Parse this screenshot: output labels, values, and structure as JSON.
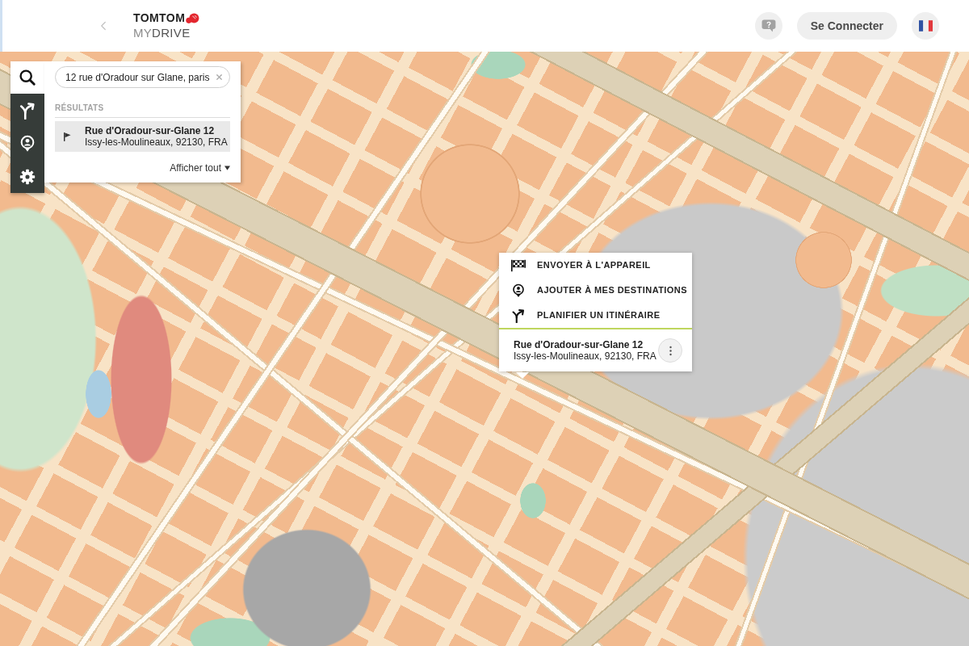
{
  "header": {
    "logo": {
      "brand": "TOMTOM",
      "product_light": "MY",
      "product_dark": "DRIVE"
    },
    "login_button": "Se Connecter"
  },
  "sidebar": {
    "items": [
      {
        "selected": true
      },
      {
        "selected": false
      },
      {
        "selected": false
      },
      {
        "selected": false
      }
    ]
  },
  "search": {
    "value": "12 rue d'Oradour sur Glane, paris",
    "results_heading": "RÉSULTATS",
    "results": [
      {
        "title": "Rue d'Oradour-sur-Glane 12",
        "address": "Issy-les-Moulineaux, 92130, FRA",
        "selected": true
      }
    ],
    "show_all": "Afficher tout"
  },
  "popup": {
    "actions": [
      {
        "label": "ENVOYER À L'APPAREIL"
      },
      {
        "label": "AJOUTER À MES DESTINATIONS"
      },
      {
        "label": "PLANIFIER UN ITINÉRAIRE"
      }
    ],
    "title": "Rue d'Oradour-sur-Glane 12",
    "address": "Issy-les-Moulineaux, 92130, FRA"
  }
}
